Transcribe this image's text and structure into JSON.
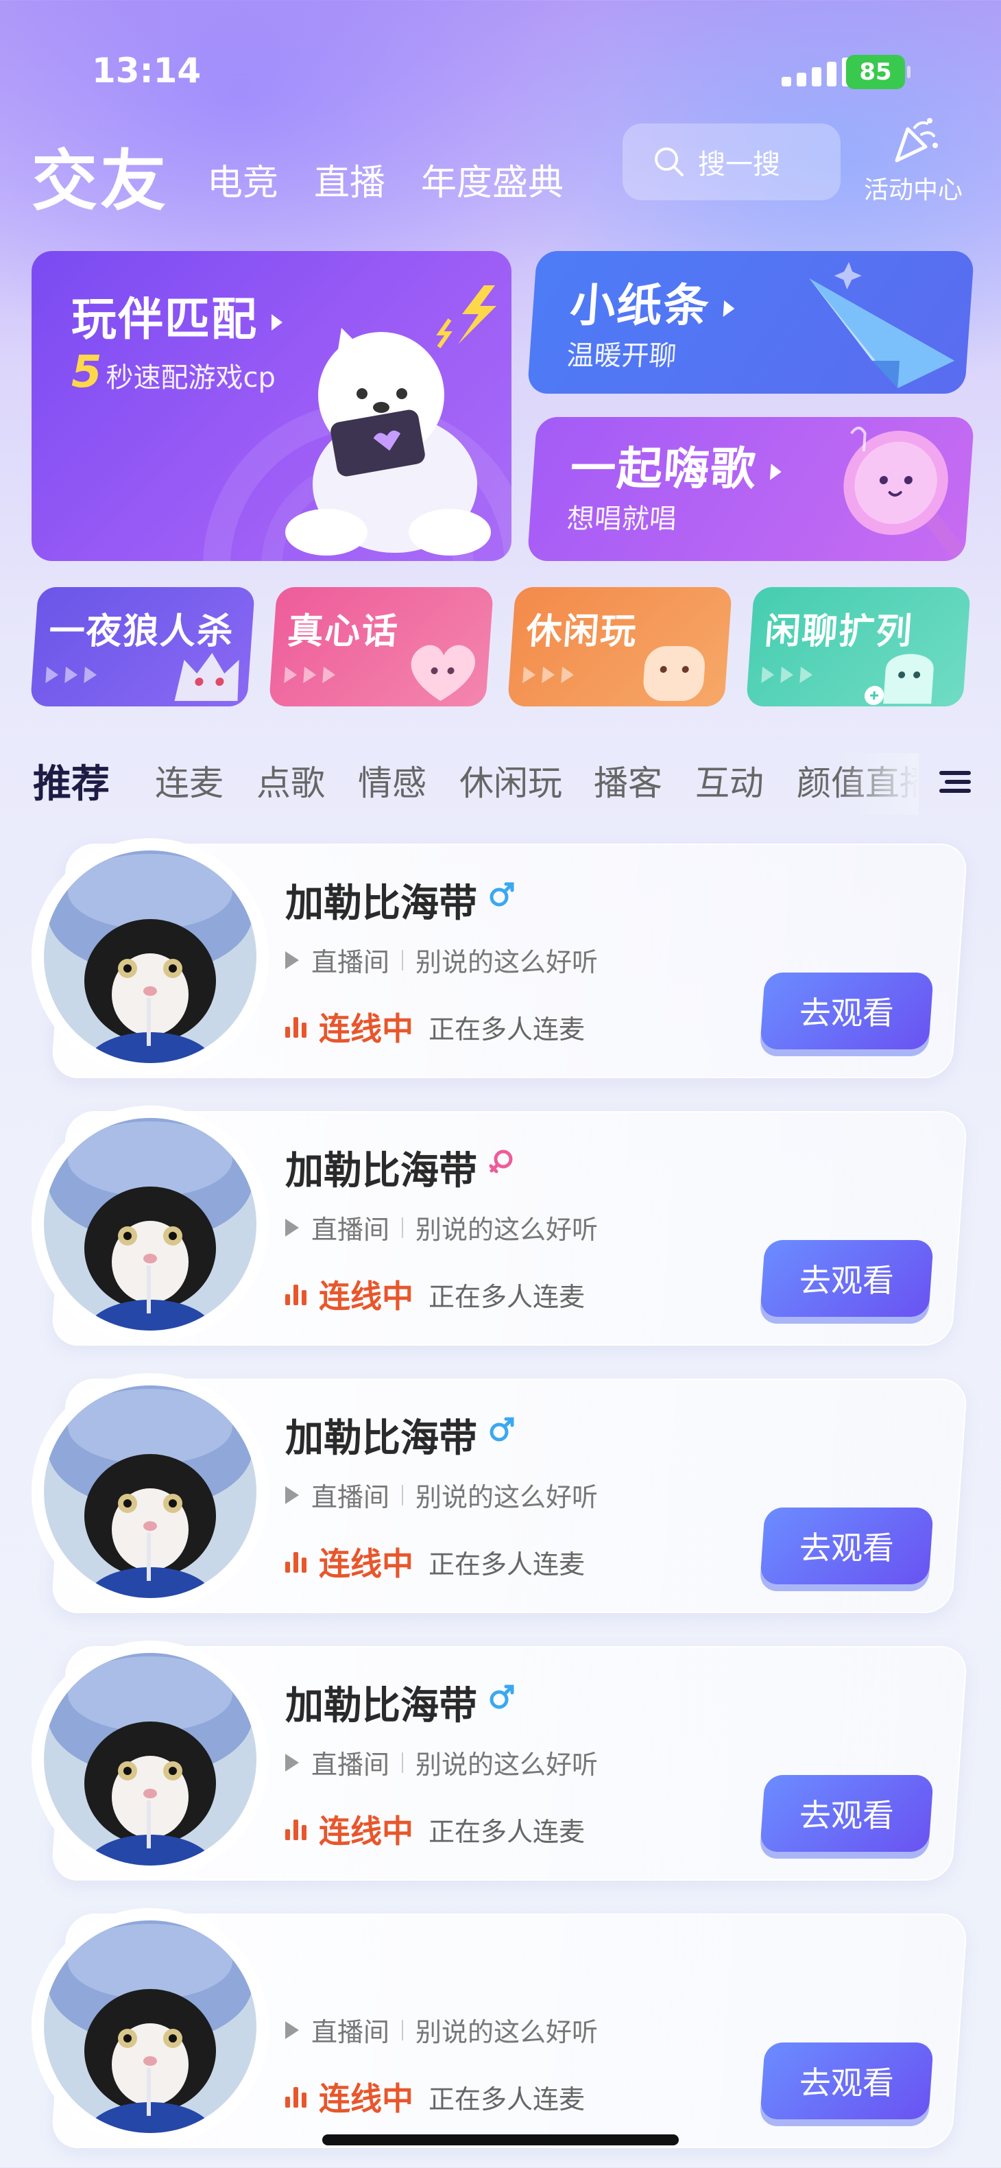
{
  "status_bar": {
    "time": "13:14",
    "battery": "85"
  },
  "header": {
    "title": "交友",
    "nav": [
      "电竞",
      "直播",
      "年度盛典"
    ],
    "search_placeholder": "搜一搜",
    "activity_label": "活动中心"
  },
  "features": {
    "match": {
      "title": "玩伴匹配",
      "highlight": "5",
      "subtitle": "秒速配游戏cp"
    },
    "note": {
      "title": "小纸条",
      "subtitle": "温暖开聊"
    },
    "sing": {
      "title": "一起嗨歌",
      "subtitle": "想唱就唱"
    }
  },
  "mini_cards": [
    {
      "label": "一夜狼人杀",
      "color": "#6f57e6"
    },
    {
      "label": "真心话",
      "color": "#ee5c9a"
    },
    {
      "label": "休闲玩",
      "color": "#f6904e"
    },
    {
      "label": "闲聊扩列",
      "color": "#4fd2b3"
    }
  ],
  "tabs": [
    "推荐",
    "连麦",
    "点歌",
    "情感",
    "休闲玩",
    "播客",
    "互动",
    "颜值直播"
  ],
  "list": [
    {
      "name": "加勒比海带",
      "gender": "male",
      "room": "直播间",
      "topic": "别说的这么好听",
      "state": "连线中",
      "desc": "正在多人连麦",
      "button": "去观看"
    },
    {
      "name": "加勒比海带",
      "gender": "female",
      "room": "直播间",
      "topic": "别说的这么好听",
      "state": "连线中",
      "desc": "正在多人连麦",
      "button": "去观看"
    },
    {
      "name": "加勒比海带",
      "gender": "male",
      "room": "直播间",
      "topic": "别说的这么好听",
      "state": "连线中",
      "desc": "正在多人连麦",
      "button": "去观看"
    },
    {
      "name": "加勒比海带",
      "gender": "male",
      "room": "直播间",
      "topic": "别说的这么好听",
      "state": "连线中",
      "desc": "正在多人连麦",
      "button": "去观看"
    },
    {
      "name": "",
      "gender": "",
      "room": "直播间",
      "topic": "别说的这么好听",
      "state": "连线中",
      "desc": "正在多人连麦",
      "button": "去观看"
    }
  ],
  "colors": {
    "accent": "#6a53f2",
    "live": "#e8562c",
    "male": "#3aa8f0",
    "female": "#ee5c9a"
  }
}
